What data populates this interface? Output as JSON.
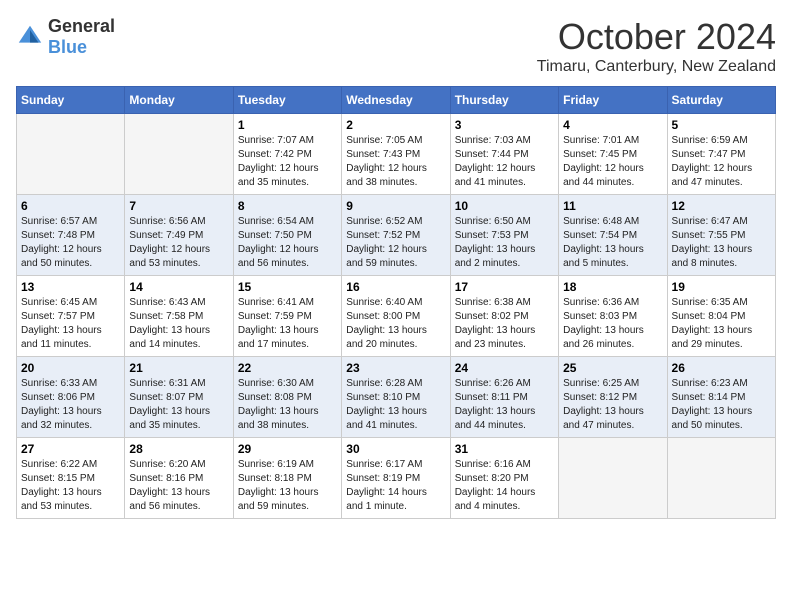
{
  "logo": {
    "general": "General",
    "blue": "Blue"
  },
  "title": "October 2024",
  "location": "Timaru, Canterbury, New Zealand",
  "days_of_week": [
    "Sunday",
    "Monday",
    "Tuesday",
    "Wednesday",
    "Thursday",
    "Friday",
    "Saturday"
  ],
  "weeks": [
    [
      {
        "day": "",
        "sunrise": "",
        "sunset": "",
        "daylight": ""
      },
      {
        "day": "",
        "sunrise": "",
        "sunset": "",
        "daylight": ""
      },
      {
        "day": "1",
        "sunrise": "Sunrise: 7:07 AM",
        "sunset": "Sunset: 7:42 PM",
        "daylight": "Daylight: 12 hours and 35 minutes."
      },
      {
        "day": "2",
        "sunrise": "Sunrise: 7:05 AM",
        "sunset": "Sunset: 7:43 PM",
        "daylight": "Daylight: 12 hours and 38 minutes."
      },
      {
        "day": "3",
        "sunrise": "Sunrise: 7:03 AM",
        "sunset": "Sunset: 7:44 PM",
        "daylight": "Daylight: 12 hours and 41 minutes."
      },
      {
        "day": "4",
        "sunrise": "Sunrise: 7:01 AM",
        "sunset": "Sunset: 7:45 PM",
        "daylight": "Daylight: 12 hours and 44 minutes."
      },
      {
        "day": "5",
        "sunrise": "Sunrise: 6:59 AM",
        "sunset": "Sunset: 7:47 PM",
        "daylight": "Daylight: 12 hours and 47 minutes."
      }
    ],
    [
      {
        "day": "6",
        "sunrise": "Sunrise: 6:57 AM",
        "sunset": "Sunset: 7:48 PM",
        "daylight": "Daylight: 12 hours and 50 minutes."
      },
      {
        "day": "7",
        "sunrise": "Sunrise: 6:56 AM",
        "sunset": "Sunset: 7:49 PM",
        "daylight": "Daylight: 12 hours and 53 minutes."
      },
      {
        "day": "8",
        "sunrise": "Sunrise: 6:54 AM",
        "sunset": "Sunset: 7:50 PM",
        "daylight": "Daylight: 12 hours and 56 minutes."
      },
      {
        "day": "9",
        "sunrise": "Sunrise: 6:52 AM",
        "sunset": "Sunset: 7:52 PM",
        "daylight": "Daylight: 12 hours and 59 minutes."
      },
      {
        "day": "10",
        "sunrise": "Sunrise: 6:50 AM",
        "sunset": "Sunset: 7:53 PM",
        "daylight": "Daylight: 13 hours and 2 minutes."
      },
      {
        "day": "11",
        "sunrise": "Sunrise: 6:48 AM",
        "sunset": "Sunset: 7:54 PM",
        "daylight": "Daylight: 13 hours and 5 minutes."
      },
      {
        "day": "12",
        "sunrise": "Sunrise: 6:47 AM",
        "sunset": "Sunset: 7:55 PM",
        "daylight": "Daylight: 13 hours and 8 minutes."
      }
    ],
    [
      {
        "day": "13",
        "sunrise": "Sunrise: 6:45 AM",
        "sunset": "Sunset: 7:57 PM",
        "daylight": "Daylight: 13 hours and 11 minutes."
      },
      {
        "day": "14",
        "sunrise": "Sunrise: 6:43 AM",
        "sunset": "Sunset: 7:58 PM",
        "daylight": "Daylight: 13 hours and 14 minutes."
      },
      {
        "day": "15",
        "sunrise": "Sunrise: 6:41 AM",
        "sunset": "Sunset: 7:59 PM",
        "daylight": "Daylight: 13 hours and 17 minutes."
      },
      {
        "day": "16",
        "sunrise": "Sunrise: 6:40 AM",
        "sunset": "Sunset: 8:00 PM",
        "daylight": "Daylight: 13 hours and 20 minutes."
      },
      {
        "day": "17",
        "sunrise": "Sunrise: 6:38 AM",
        "sunset": "Sunset: 8:02 PM",
        "daylight": "Daylight: 13 hours and 23 minutes."
      },
      {
        "day": "18",
        "sunrise": "Sunrise: 6:36 AM",
        "sunset": "Sunset: 8:03 PM",
        "daylight": "Daylight: 13 hours and 26 minutes."
      },
      {
        "day": "19",
        "sunrise": "Sunrise: 6:35 AM",
        "sunset": "Sunset: 8:04 PM",
        "daylight": "Daylight: 13 hours and 29 minutes."
      }
    ],
    [
      {
        "day": "20",
        "sunrise": "Sunrise: 6:33 AM",
        "sunset": "Sunset: 8:06 PM",
        "daylight": "Daylight: 13 hours and 32 minutes."
      },
      {
        "day": "21",
        "sunrise": "Sunrise: 6:31 AM",
        "sunset": "Sunset: 8:07 PM",
        "daylight": "Daylight: 13 hours and 35 minutes."
      },
      {
        "day": "22",
        "sunrise": "Sunrise: 6:30 AM",
        "sunset": "Sunset: 8:08 PM",
        "daylight": "Daylight: 13 hours and 38 minutes."
      },
      {
        "day": "23",
        "sunrise": "Sunrise: 6:28 AM",
        "sunset": "Sunset: 8:10 PM",
        "daylight": "Daylight: 13 hours and 41 minutes."
      },
      {
        "day": "24",
        "sunrise": "Sunrise: 6:26 AM",
        "sunset": "Sunset: 8:11 PM",
        "daylight": "Daylight: 13 hours and 44 minutes."
      },
      {
        "day": "25",
        "sunrise": "Sunrise: 6:25 AM",
        "sunset": "Sunset: 8:12 PM",
        "daylight": "Daylight: 13 hours and 47 minutes."
      },
      {
        "day": "26",
        "sunrise": "Sunrise: 6:23 AM",
        "sunset": "Sunset: 8:14 PM",
        "daylight": "Daylight: 13 hours and 50 minutes."
      }
    ],
    [
      {
        "day": "27",
        "sunrise": "Sunrise: 6:22 AM",
        "sunset": "Sunset: 8:15 PM",
        "daylight": "Daylight: 13 hours and 53 minutes."
      },
      {
        "day": "28",
        "sunrise": "Sunrise: 6:20 AM",
        "sunset": "Sunset: 8:16 PM",
        "daylight": "Daylight: 13 hours and 56 minutes."
      },
      {
        "day": "29",
        "sunrise": "Sunrise: 6:19 AM",
        "sunset": "Sunset: 8:18 PM",
        "daylight": "Daylight: 13 hours and 59 minutes."
      },
      {
        "day": "30",
        "sunrise": "Sunrise: 6:17 AM",
        "sunset": "Sunset: 8:19 PM",
        "daylight": "Daylight: 14 hours and 1 minute."
      },
      {
        "day": "31",
        "sunrise": "Sunrise: 6:16 AM",
        "sunset": "Sunset: 8:20 PM",
        "daylight": "Daylight: 14 hours and 4 minutes."
      },
      {
        "day": "",
        "sunrise": "",
        "sunset": "",
        "daylight": ""
      },
      {
        "day": "",
        "sunrise": "",
        "sunset": "",
        "daylight": ""
      }
    ]
  ]
}
